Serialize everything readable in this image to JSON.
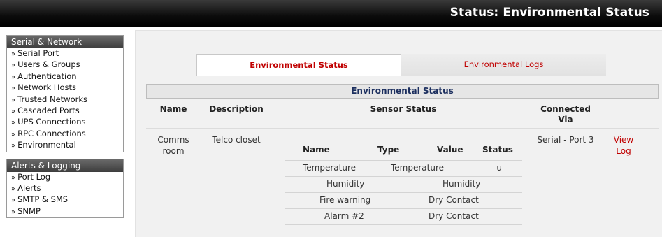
{
  "header": {
    "title": "Status: Environmental Status"
  },
  "sidebar": {
    "sections": [
      {
        "title": "Serial & Network",
        "items": [
          "Serial Port",
          "Users & Groups",
          "Authentication",
          "Network Hosts",
          "Trusted Networks",
          "Cascaded Ports",
          "UPS Connections",
          "RPC Connections",
          "Environmental"
        ]
      },
      {
        "title": "Alerts & Logging",
        "items": [
          "Port Log",
          "Alerts",
          "SMTP & SMS",
          "SNMP"
        ]
      }
    ],
    "bullet": "»"
  },
  "tabs": {
    "active": "Environmental Status",
    "inactive": "Environmental Logs"
  },
  "panel": {
    "title": "Environmental Status",
    "columns": {
      "name": "Name",
      "description": "Description",
      "sensor_status": "Sensor Status",
      "connected_via": "Connected Via"
    },
    "device": {
      "name": "Comms room",
      "description": "Telco closet",
      "connected_via": "Serial - Port 3",
      "action": "View Log"
    },
    "sensor_columns": {
      "name": "Name",
      "type": "Type",
      "value": "Value",
      "status": "Status"
    },
    "sensors": [
      {
        "name": "Temperature",
        "type": "Temperature",
        "value": "",
        "status": "-u"
      },
      {
        "name": "Humidity",
        "type": "Humidity",
        "value": "",
        "status": ""
      },
      {
        "name": "Fire warning",
        "type": "Dry Contact",
        "value": "",
        "status": ""
      },
      {
        "name": "Alarm #2",
        "type": "Dry Contact",
        "value": "",
        "status": ""
      }
    ]
  },
  "colors": {
    "accent_red": "#c00000",
    "header_bg": "#000000",
    "section_title_blue": "#1c2f5f"
  }
}
